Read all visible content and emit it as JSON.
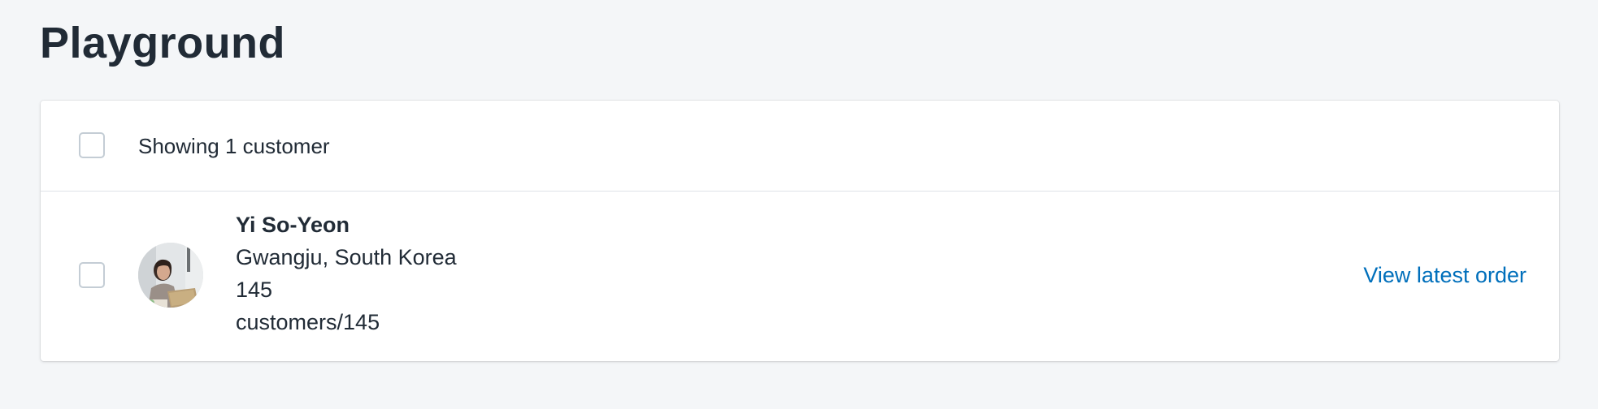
{
  "page": {
    "title": "Playground"
  },
  "list": {
    "header_text": "Showing 1 customer",
    "items": [
      {
        "name": "Yi So-Yeon",
        "location": "Gwangju, South Korea",
        "id": "145",
        "url": "customers/145",
        "action_label": "View latest order"
      }
    ]
  },
  "colors": {
    "background": "#f4f6f8",
    "text": "#212b36",
    "link": "#006fbb",
    "divider": "#dfe3e8"
  }
}
